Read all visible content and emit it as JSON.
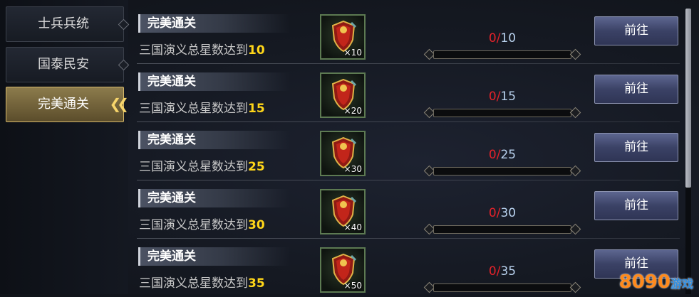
{
  "sidebar": {
    "tabs": [
      {
        "label": "士兵兵统",
        "active": false
      },
      {
        "label": "国泰民安",
        "active": false
      },
      {
        "label": "完美通关",
        "active": true
      }
    ]
  },
  "tasks": [
    {
      "title": "完美通关",
      "desc_prefix": "三国演义总星数达到",
      "target": "10",
      "reward_qty": "×10",
      "current": "0",
      "total": "10",
      "progress": 0,
      "button": "前往"
    },
    {
      "title": "完美通关",
      "desc_prefix": "三国演义总星数达到",
      "target": "15",
      "reward_qty": "×20",
      "current": "0",
      "total": "15",
      "progress": 0,
      "button": "前往"
    },
    {
      "title": "完美通关",
      "desc_prefix": "三国演义总星数达到",
      "target": "25",
      "reward_qty": "×30",
      "current": "0",
      "total": "25",
      "progress": 0,
      "button": "前往"
    },
    {
      "title": "完美通关",
      "desc_prefix": "三国演义总星数达到",
      "target": "30",
      "reward_qty": "×40",
      "current": "0",
      "total": "30",
      "progress": 0,
      "button": "前往"
    },
    {
      "title": "完美通关",
      "desc_prefix": "三国演义总星数达到",
      "target": "35",
      "reward_qty": "×50",
      "current": "0",
      "total": "35",
      "progress": 0,
      "button": "前往"
    }
  ],
  "watermark": {
    "brand": "8090",
    "suffix": "游戏"
  },
  "colors": {
    "accent_gold": "#ffd619",
    "progress_current": "#e4222a",
    "progress_total": "#b9d2ee"
  },
  "icons": {
    "reward": "shield-icon"
  }
}
